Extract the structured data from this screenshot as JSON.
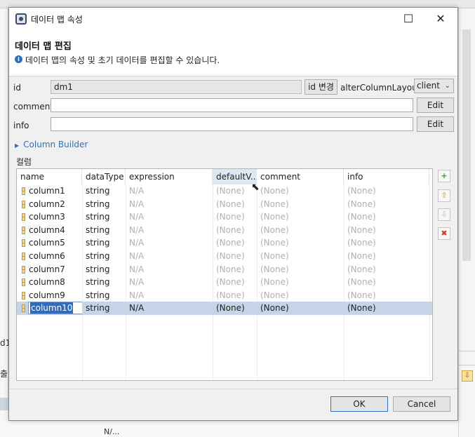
{
  "background": {
    "left_fragment_a": "d1",
    "left_fragment_b": "출력",
    "bottom_fragment": "N/..."
  },
  "dialog": {
    "title": "데이터 맵 속성",
    "header_title": "데이터 맵 편집",
    "header_desc": "데이터 맵의 속성 및 초기 데이터를 편집할 수 있습니다.",
    "window_buttons": {
      "minimize": "☐",
      "close": "✕"
    }
  },
  "form": {
    "id_label": "id",
    "id_value": "dm1",
    "id_change_button": "id 변경",
    "alter_label": "alterColumnLayout",
    "alter_value": "client",
    "comment_label": "comment",
    "comment_value": "",
    "comment_edit": "Edit",
    "info_label": "info",
    "info_value": "",
    "info_edit": "Edit",
    "column_builder": "Column Builder",
    "columns_section": "컬럼"
  },
  "table": {
    "headers": [
      "name",
      "dataType",
      "expression",
      "defaultV...",
      "comment",
      "info"
    ],
    "rows": [
      [
        "column1",
        "string",
        "N/A",
        "(None)",
        "(None)",
        "(None)"
      ],
      [
        "column2",
        "string",
        "N/A",
        "(None)",
        "(None)",
        "(None)"
      ],
      [
        "column3",
        "string",
        "N/A",
        "(None)",
        "(None)",
        "(None)"
      ],
      [
        "column4",
        "string",
        "N/A",
        "(None)",
        "(None)",
        "(None)"
      ],
      [
        "column5",
        "string",
        "N/A",
        "(None)",
        "(None)",
        "(None)"
      ],
      [
        "column6",
        "string",
        "N/A",
        "(None)",
        "(None)",
        "(None)"
      ],
      [
        "column7",
        "string",
        "N/A",
        "(None)",
        "(None)",
        "(None)"
      ],
      [
        "column8",
        "string",
        "N/A",
        "(None)",
        "(None)",
        "(None)"
      ],
      [
        "column9",
        "string",
        "N/A",
        "(None)",
        "(None)",
        "(None)"
      ],
      [
        "column10",
        "string",
        "N/A",
        "(None)",
        "(None)",
        "(None)"
      ]
    ],
    "selected_row": 9,
    "side_buttons": {
      "add": "add-column-icon",
      "up": "move-up-icon",
      "down": "move-down-icon",
      "delete": "delete-icon"
    }
  },
  "footer": {
    "ok": "OK",
    "cancel": "Cancel"
  },
  "colors": {
    "selection": "#c5d4e6",
    "link": "#2f6fbd",
    "ok_border": "#2f74c8"
  }
}
